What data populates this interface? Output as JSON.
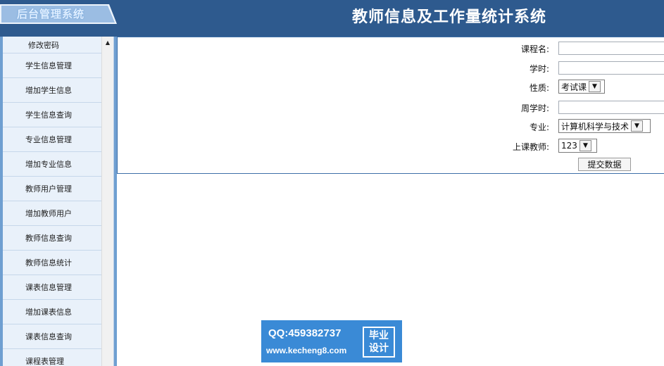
{
  "header": {
    "logo_text": "后台管理系统",
    "app_title": "教师信息及工作量统计系统"
  },
  "sidebar": {
    "items": [
      {
        "label": "修改密码"
      },
      {
        "label": "学生信息管理"
      },
      {
        "label": "增加学生信息"
      },
      {
        "label": "学生信息查询"
      },
      {
        "label": "专业信息管理"
      },
      {
        "label": "增加专业信息"
      },
      {
        "label": "教师用户管理"
      },
      {
        "label": "增加教师用户"
      },
      {
        "label": "教师信息查询"
      },
      {
        "label": "教师信息统计"
      },
      {
        "label": "课表信息管理"
      },
      {
        "label": "增加课表信息"
      },
      {
        "label": "课表信息查询"
      },
      {
        "label": "课程表管理"
      }
    ]
  },
  "form": {
    "course_name": {
      "label": "课程名:",
      "value": ""
    },
    "hours": {
      "label": "学时:",
      "value": ""
    },
    "nature": {
      "label": "性质:",
      "selected": "考试课"
    },
    "weekly_hours": {
      "label": "周学时:",
      "value": ""
    },
    "major": {
      "label": "专业:",
      "selected": "计算机科学与技术"
    },
    "teacher": {
      "label": "上课教师:",
      "selected": "123"
    },
    "submit_label": "提交数据"
  },
  "watermark": {
    "qq": "QQ:459382737",
    "url": "www.kecheng8.com",
    "badge_line1": "毕业",
    "badge_line2": "设计"
  },
  "colors": {
    "header_bg": "#2e5a8e",
    "sidebar_bg": "#e9f1fa",
    "accent": "#3d6fa8"
  }
}
